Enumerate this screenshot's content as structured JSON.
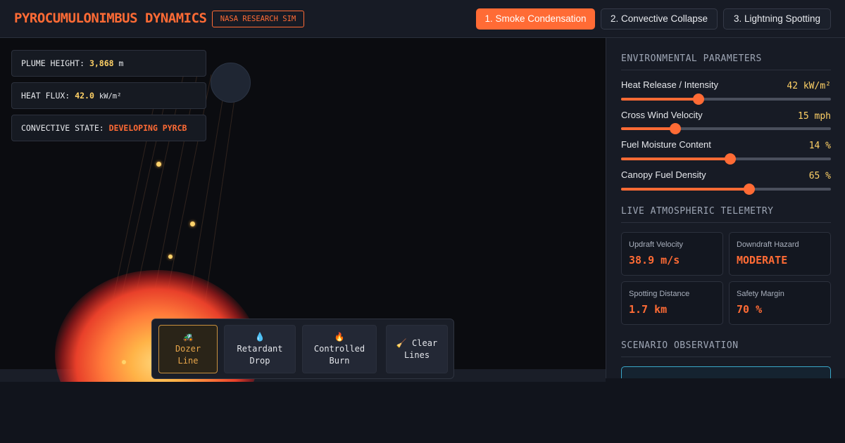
{
  "header": {
    "title": "PYROCUMULONIMBUS DYNAMICS",
    "badge": "NASA RESEARCH SIM",
    "tabs": [
      {
        "label": "1. Smoke Condensation",
        "active": true
      },
      {
        "label": "2. Convective Collapse",
        "active": false
      },
      {
        "label": "3. Lightning Spotting",
        "active": false
      }
    ]
  },
  "readouts": {
    "plume_height": {
      "label": "PLUME HEIGHT:",
      "value": "3,868",
      "unit": "m"
    },
    "heat_flux": {
      "label": "HEAT FLUX:",
      "value": "42.0",
      "unit": "kW/m²"
    },
    "convective_state": {
      "label": "CONVECTIVE STATE:",
      "value": "DEVELOPING PYRCB"
    }
  },
  "tools": [
    {
      "icon": "🚜",
      "icon_name": "bulldozer-icon",
      "label_line1": "Dozer",
      "label_line2": "Line",
      "active": true
    },
    {
      "icon": "💧",
      "icon_name": "droplet-icon",
      "label_line1": "Retardant",
      "label_line2": "Drop",
      "active": false
    },
    {
      "icon": "🔥",
      "icon_name": "fire-icon",
      "label_line1": "Controlled",
      "label_line2": "Burn",
      "active": false
    },
    {
      "icon": "🧹",
      "icon_name": "broom-icon",
      "label_line1": "Clear",
      "label_line2": "Lines",
      "active": false
    }
  ],
  "panel": {
    "env_title": "ENVIRONMENTAL PARAMETERS",
    "sliders": [
      {
        "label": "Heat Release / Intensity",
        "value": "42",
        "unit": "kW/m²",
        "fraction": 0.37
      },
      {
        "label": "Cross Wind Velocity",
        "value": "15",
        "unit": "mph",
        "fraction": 0.26
      },
      {
        "label": "Fuel Moisture Content",
        "value": "14",
        "unit": "%",
        "fraction": 0.52
      },
      {
        "label": "Canopy Fuel Density",
        "value": "65",
        "unit": "%",
        "fraction": 0.61
      }
    ],
    "telemetry_title": "LIVE ATMOSPHERIC TELEMETRY",
    "telemetry": [
      {
        "label": "Updraft Velocity",
        "value": "38.9 m/s"
      },
      {
        "label": "Downdraft Hazard",
        "value": "MODERATE"
      },
      {
        "label": "Spotting Distance",
        "value": "1.7 km"
      },
      {
        "label": "Safety Margin",
        "value": "70 %"
      }
    ],
    "observation_title": "SCENARIO OBSERVATION"
  },
  "colors": {
    "accent": "#ff6b35",
    "value_yellow": "#ffd166",
    "observation_border": "#3aa7c9"
  }
}
